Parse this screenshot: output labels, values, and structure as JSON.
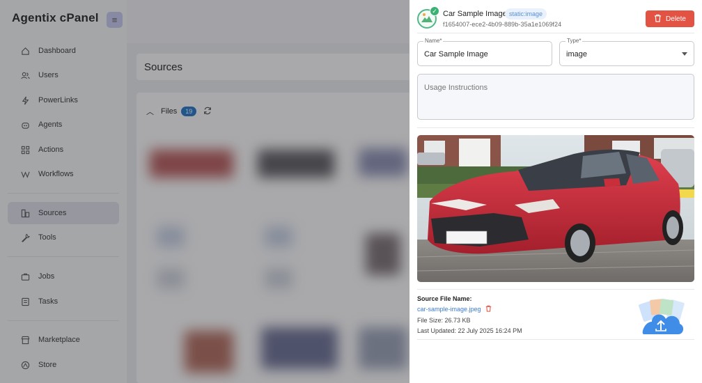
{
  "app": {
    "name": "Agentix cPanel"
  },
  "sidebar": {
    "items": [
      {
        "label": "Dashboard",
        "icon": "home-icon"
      },
      {
        "label": "Users",
        "icon": "users-icon"
      },
      {
        "label": "PowerLinks",
        "icon": "lightning-icon"
      },
      {
        "label": "Agents",
        "icon": "robot-icon"
      },
      {
        "label": "Actions",
        "icon": "grid-icon"
      },
      {
        "label": "Workflows",
        "icon": "workflow-icon"
      },
      {
        "label": "Sources",
        "icon": "database-icon",
        "active": true
      },
      {
        "label": "Tools",
        "icon": "wrench-icon"
      },
      {
        "label": "Jobs",
        "icon": "briefcase-icon"
      },
      {
        "label": "Tasks",
        "icon": "checklist-icon"
      },
      {
        "label": "Marketplace",
        "icon": "store-icon"
      },
      {
        "label": "Store",
        "icon": "shop-icon"
      }
    ]
  },
  "page": {
    "title": "Sources"
  },
  "files": {
    "label": "Files",
    "count": "19"
  },
  "drawer": {
    "title": "Car Sample Image",
    "tag": "static:image",
    "id": "f1654007-ece2-4b09-889b-35a1e1069f24",
    "delete_label": "Delete",
    "name_field": {
      "label": "Name*",
      "value": "Car Sample Image"
    },
    "type_field": {
      "label": "Type*",
      "value": "image"
    },
    "usage_placeholder": "Usage Instructions",
    "source": {
      "heading": "Source File Name:",
      "file_name": "car-sample-image.jpeg",
      "size": "File Size: 26.73 KB",
      "updated": "Last Updated: 22 July 2025 16:24 PM"
    }
  },
  "colors": {
    "accent": "#1f73c9",
    "danger": "#e35343",
    "success": "#3bb273",
    "active_nav": "#dfe1ec"
  }
}
